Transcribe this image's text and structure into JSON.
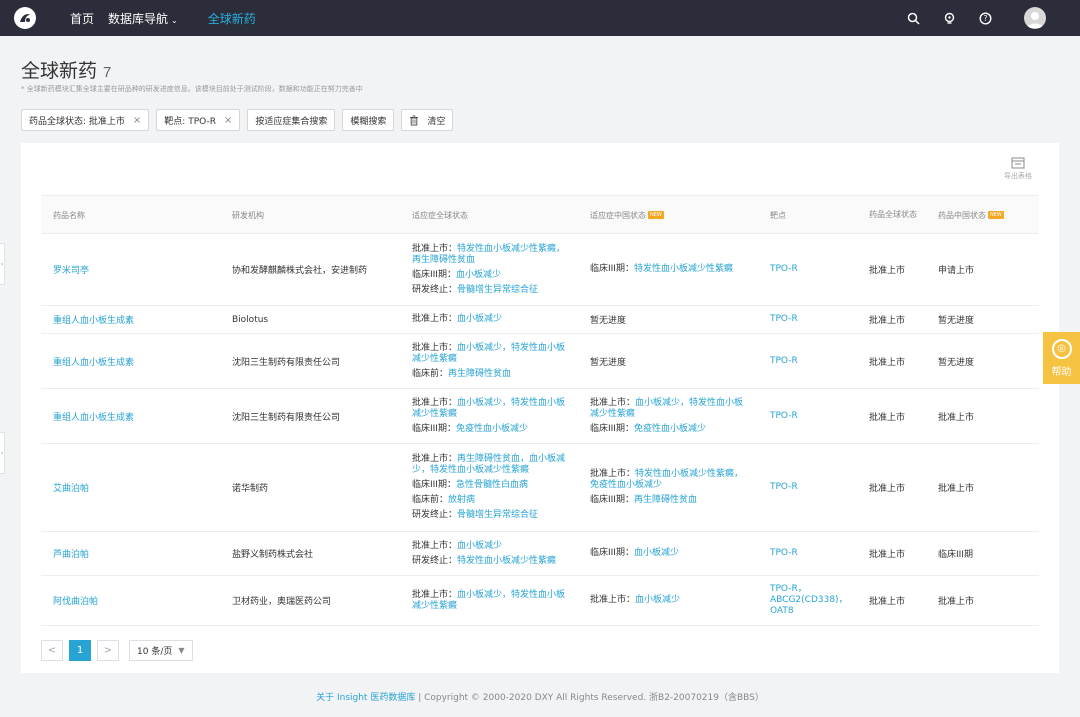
{
  "nav": {
    "home": "首页",
    "db_nav": "数据库导航",
    "active": "全球新药"
  },
  "icons": [
    "search-icon",
    "bulb-icon",
    "help-icon",
    "user-avatar"
  ],
  "page": {
    "title": "全球新药",
    "count": "7",
    "note": "* 全球新药模块汇集全球主要在研品种的研发进度信息。该模块目前处于测试阶段，数据和功能正在努力完善中"
  },
  "filters": [
    {
      "label": "药品全球状态: 批准上市",
      "removable": true
    },
    {
      "label": "靶点: TPO-R",
      "removable": true
    },
    {
      "label": "按适应症集合搜索",
      "removable": false
    },
    {
      "label": "模糊搜索",
      "removable": false
    },
    {
      "label": "清空",
      "removable": false
    }
  ],
  "export_label": "导出表格",
  "columns": {
    "drug": "药品名称",
    "org": "研发机构",
    "global_indication": "适应症全球状态",
    "china_indication": "适应症中国状态",
    "target": "靶点",
    "global_status": "药品全球状态",
    "china_status": "药品中国状态",
    "new_badge": "NEW"
  },
  "rows": [
    {
      "drug": "罗米司亭",
      "org": "协和发酵麒麟株式会社，安进制药",
      "global": [
        {
          "label": "批准上市：",
          "values": [
            "特发性血小板减少性紫癜，",
            "再生障碍性贫血"
          ]
        },
        {
          "label": "临床III期：",
          "values": [
            "血小板减少"
          ]
        },
        {
          "label": "研发终止：",
          "values": [
            "骨髓增生异常综合征"
          ]
        }
      ],
      "china": [
        {
          "label": "临床III期：",
          "values": [
            "特发性血小板减少性紫癜"
          ]
        }
      ],
      "target": [
        "TPO-R"
      ],
      "global_status": "批准上市",
      "china_status": "申请上市"
    },
    {
      "drug": "重组人血小板生成素",
      "org": "Biolotus",
      "global": [
        {
          "label": "批准上市：",
          "values": [
            "血小板减少"
          ]
        }
      ],
      "china_text": "暂无进度",
      "target": [
        "TPO-R"
      ],
      "global_status": "批准上市",
      "china_status": "暂无进度"
    },
    {
      "drug": "重组人血小板生成素",
      "org": "沈阳三生制药有限责任公司",
      "global": [
        {
          "label": "批准上市：",
          "values": [
            "血小板减少，",
            "特发性血小板",
            "减少性紫癜"
          ]
        },
        {
          "label": "临床前：",
          "values": [
            "再生障碍性贫血"
          ]
        }
      ],
      "china_text": "暂无进度",
      "target": [
        "TPO-R"
      ],
      "global_status": "批准上市",
      "china_status": "暂无进度"
    },
    {
      "drug": "重组人血小板生成素",
      "org": "沈阳三生制药有限责任公司",
      "global": [
        {
          "label": "批准上市：",
          "values": [
            "血小板减少，",
            "特发性血小板",
            "减少性紫癜"
          ]
        },
        {
          "label": "临床III期：",
          "values": [
            "免疫性血小板减少"
          ]
        }
      ],
      "china": [
        {
          "label": "批准上市：",
          "values": [
            "血小板减少，",
            "特发性血小板",
            "减少性紫癜"
          ]
        },
        {
          "label": "临床III期：",
          "values": [
            "免疫性血小板减少"
          ]
        }
      ],
      "target": [
        "TPO-R"
      ],
      "global_status": "批准上市",
      "china_status": "批准上市"
    },
    {
      "drug": "艾曲泊帕",
      "org": "诺华制药",
      "global": [
        {
          "label": "批准上市：",
          "values": [
            "再生障碍性贫血，",
            "血小板减",
            "少，",
            "特发性血小板减少性紫癜"
          ]
        },
        {
          "label": "临床III期：",
          "values": [
            "急性骨髓性白血病"
          ]
        },
        {
          "label": "临床前：",
          "values": [
            "放射病"
          ]
        },
        {
          "label": "研发终止：",
          "values": [
            "骨髓增生异常综合征"
          ]
        }
      ],
      "china": [
        {
          "label": "批准上市：",
          "values": [
            "特发性血小板减少性紫癜，",
            "免疫性血小板减少"
          ]
        },
        {
          "label": "临床III期：",
          "values": [
            "再生障碍性贫血"
          ]
        }
      ],
      "target": [
        "TPO-R"
      ],
      "global_status": "批准上市",
      "china_status": "批准上市"
    },
    {
      "drug": "芦曲泊帕",
      "org": "盐野义制药株式会社",
      "global": [
        {
          "label": "批准上市：",
          "values": [
            "血小板减少"
          ]
        },
        {
          "label": "研发终止：",
          "values": [
            "特发性血小板减少性紫癜"
          ]
        }
      ],
      "china": [
        {
          "label": "临床III期：",
          "values": [
            "血小板减少"
          ]
        }
      ],
      "target": [
        "TPO-R"
      ],
      "global_status": "批准上市",
      "china_status": "临床III期"
    },
    {
      "drug": "阿伐曲泊帕",
      "org": "卫材药业，奥瑞医药公司",
      "global": [
        {
          "label": "批准上市：",
          "values": [
            "血小板减少，",
            "特发性血小板",
            "减少性紫癜"
          ]
        }
      ],
      "china": [
        {
          "label": "批准上市：",
          "values": [
            "血小板减少"
          ]
        }
      ],
      "target": [
        "TPO-R，",
        "ABCG2(CD338)，",
        "OAT8"
      ],
      "global_status": "批准上市",
      "china_status": "批准上市"
    }
  ],
  "pagination": {
    "prev": "<",
    "current": "1",
    "next": ">",
    "page_size": "10 条/页"
  },
  "footer": {
    "link": "关于 Insight 医药数据库",
    "text": "  |  Copyright © 2000-2020 DXY All Rights Reserved. 浙B2-20070219（含BBS）"
  },
  "help_label": "帮助"
}
